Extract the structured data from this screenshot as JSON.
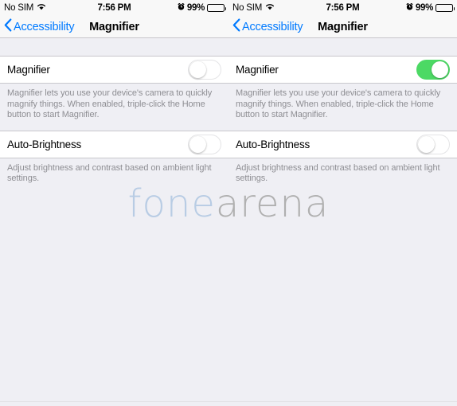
{
  "watermark": {
    "part1": "fone",
    "part2": "arena",
    "color1": "#b8cce4",
    "color2": "#b0b0b0"
  },
  "accent_color": "#007aff",
  "toggle_on_color": "#4cd964",
  "panels": [
    {
      "status_bar": {
        "carrier": "No SIM",
        "time": "7:56 PM",
        "battery_percent": "99%"
      },
      "nav": {
        "back_label": "Accessibility",
        "title": "Magnifier"
      },
      "sections": [
        {
          "row_label": "Magnifier",
          "toggle_state": "off",
          "footer": "Magnifier lets you use your device's camera to quickly magnify things. When enabled, triple-click the Home button to start Magnifier."
        },
        {
          "row_label": "Auto-Brightness",
          "toggle_state": "off",
          "footer": "Adjust brightness and contrast based on ambient light settings."
        }
      ]
    },
    {
      "status_bar": {
        "carrier": "No SIM",
        "time": "7:56 PM",
        "battery_percent": "99%"
      },
      "nav": {
        "back_label": "Accessibility",
        "title": "Magnifier"
      },
      "sections": [
        {
          "row_label": "Magnifier",
          "toggle_state": "on",
          "footer": "Magnifier lets you use your device's camera to quickly magnify things. When enabled, triple-click the Home button to start Magnifier."
        },
        {
          "row_label": "Auto-Brightness",
          "toggle_state": "off",
          "footer": "Adjust brightness and contrast based on ambient light settings."
        }
      ]
    }
  ]
}
